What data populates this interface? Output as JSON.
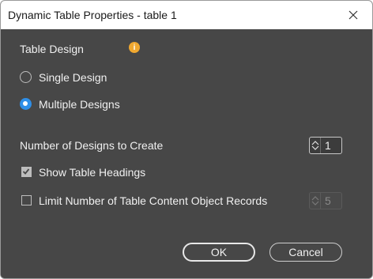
{
  "window": {
    "title": "Dynamic Table Properties - table 1"
  },
  "table_design": {
    "label": "Table Design",
    "info_icon": "info-icon",
    "options": [
      {
        "label": "Single Design",
        "selected": false
      },
      {
        "label": "Multiple Designs",
        "selected": true
      }
    ]
  },
  "designs_count": {
    "label": "Number of Designs to Create",
    "value": "1"
  },
  "show_headings": {
    "label": "Show Table Headings",
    "checked": true
  },
  "limit_records": {
    "label": "Limit Number of Table Content Object Records",
    "checked": false,
    "value": "5"
  },
  "buttons": {
    "ok": "OK",
    "cancel": "Cancel"
  },
  "colors": {
    "background": "#474747",
    "accent": "#2f8fe8",
    "info": "#f0a830"
  }
}
